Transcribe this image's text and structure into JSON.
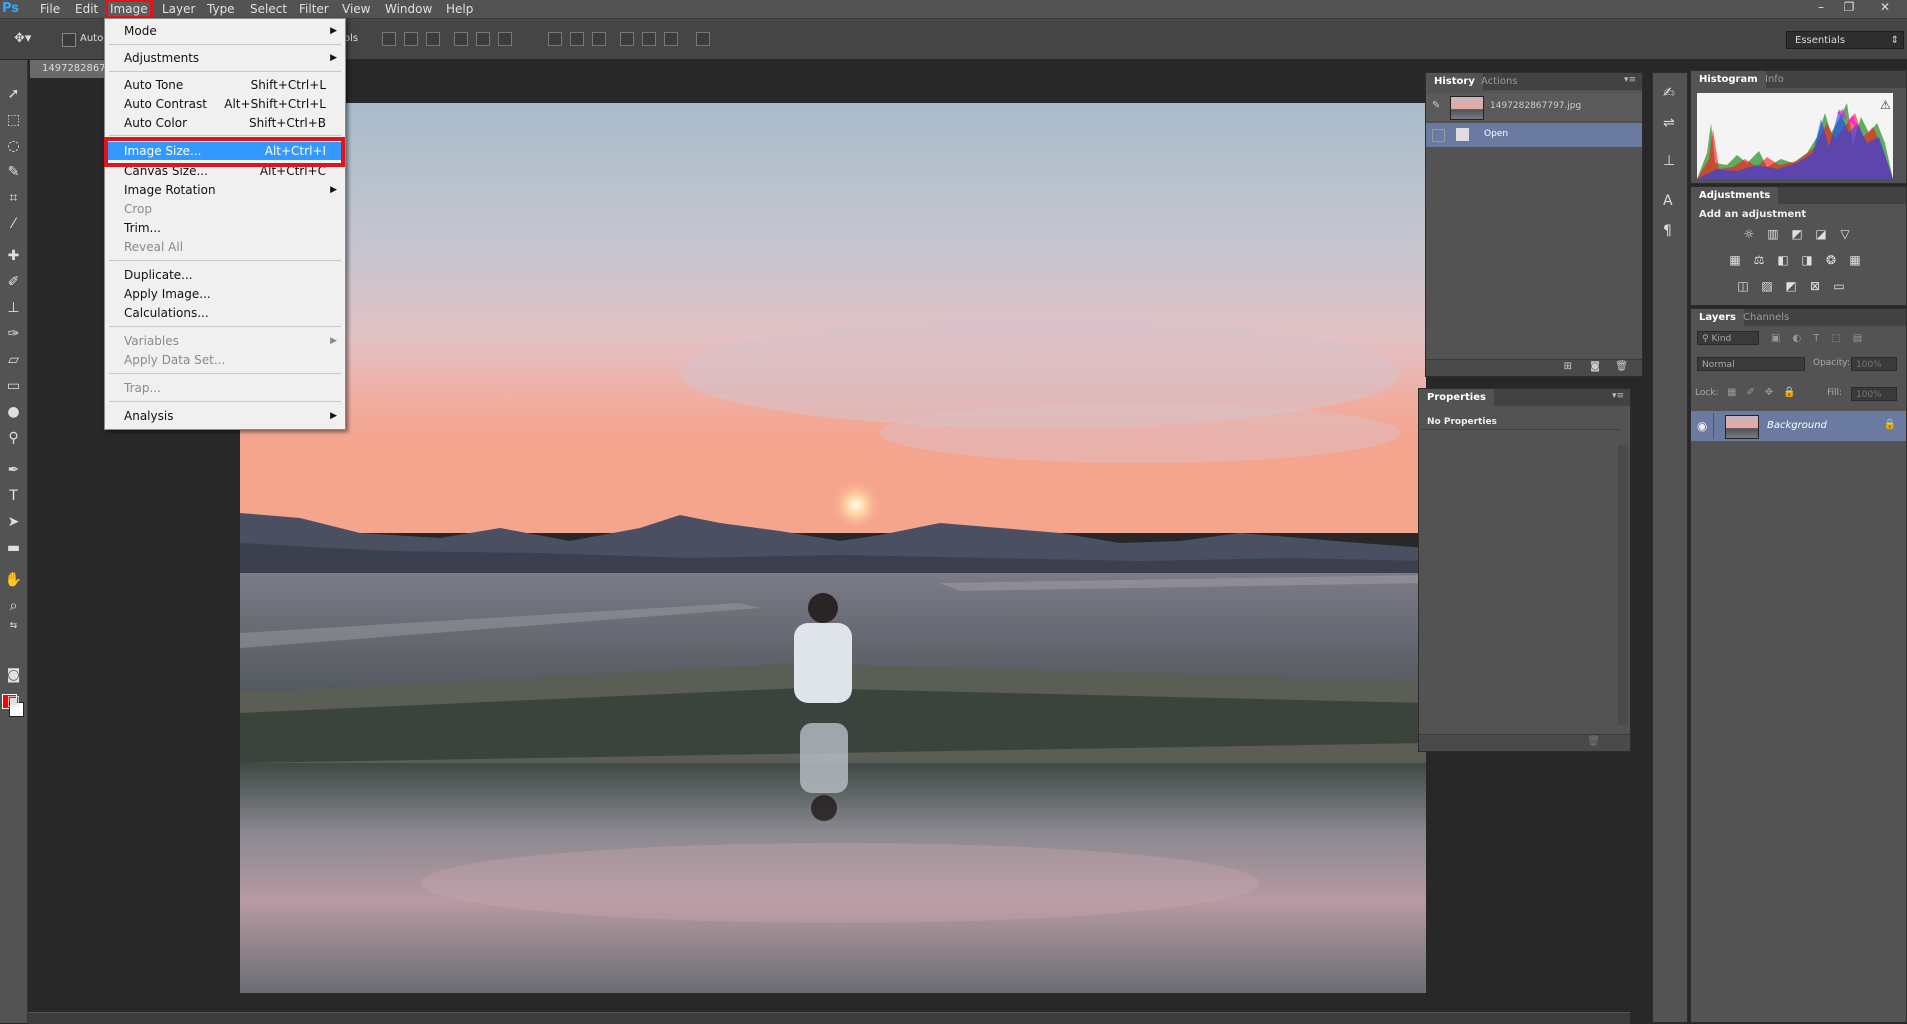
{
  "app": {
    "logo": "Ps"
  },
  "menubar": {
    "items": [
      "File",
      "Edit",
      "Image",
      "Layer",
      "Type",
      "Select",
      "Filter",
      "View",
      "Window",
      "Help"
    ],
    "active": "Image",
    "window_controls": [
      "–",
      "❐",
      "✕"
    ]
  },
  "options_bar": {
    "auto_select_label": "Auto-",
    "show_transform_label": "ols",
    "workspace": "Essentials"
  },
  "document": {
    "tab_title": "1497282867"
  },
  "image_menu": {
    "items": [
      {
        "label": "Mode",
        "shortcut": "",
        "submenu": true,
        "disabled": false,
        "highlighted": false
      },
      {
        "label": "Adjustments",
        "shortcut": "",
        "submenu": true,
        "disabled": false,
        "highlighted": false
      },
      {
        "label": "Auto Tone",
        "shortcut": "Shift+Ctrl+L",
        "submenu": false,
        "disabled": false,
        "highlighted": false
      },
      {
        "label": "Auto Contrast",
        "shortcut": "Alt+Shift+Ctrl+L",
        "submenu": false,
        "disabled": false,
        "highlighted": false
      },
      {
        "label": "Auto Color",
        "shortcut": "Shift+Ctrl+B",
        "submenu": false,
        "disabled": false,
        "highlighted": false
      },
      {
        "label": "Image Size...",
        "shortcut": "Alt+Ctrl+I",
        "submenu": false,
        "disabled": false,
        "highlighted": true
      },
      {
        "label": "Canvas Size...",
        "shortcut": "Alt+Ctrl+C",
        "submenu": false,
        "disabled": false,
        "highlighted": false
      },
      {
        "label": "Image Rotation",
        "shortcut": "",
        "submenu": true,
        "disabled": false,
        "highlighted": false
      },
      {
        "label": "Crop",
        "shortcut": "",
        "submenu": false,
        "disabled": true,
        "highlighted": false
      },
      {
        "label": "Trim...",
        "shortcut": "",
        "submenu": false,
        "disabled": false,
        "highlighted": false
      },
      {
        "label": "Reveal All",
        "shortcut": "",
        "submenu": false,
        "disabled": true,
        "highlighted": false
      },
      {
        "label": "Duplicate...",
        "shortcut": "",
        "submenu": false,
        "disabled": false,
        "highlighted": false
      },
      {
        "label": "Apply Image...",
        "shortcut": "",
        "submenu": false,
        "disabled": false,
        "highlighted": false
      },
      {
        "label": "Calculations...",
        "shortcut": "",
        "submenu": false,
        "disabled": false,
        "highlighted": false
      },
      {
        "label": "Variables",
        "shortcut": "",
        "submenu": true,
        "disabled": true,
        "highlighted": false
      },
      {
        "label": "Apply Data Set...",
        "shortcut": "",
        "submenu": false,
        "disabled": true,
        "highlighted": false
      },
      {
        "label": "Trap...",
        "shortcut": "",
        "submenu": false,
        "disabled": true,
        "highlighted": false
      },
      {
        "label": "Analysis",
        "shortcut": "",
        "submenu": true,
        "disabled": false,
        "highlighted": false
      }
    ]
  },
  "history_panel": {
    "tabs": [
      "History",
      "Actions"
    ],
    "snapshot_name": "1497282867797.jpg",
    "states": [
      "Open"
    ]
  },
  "properties_panel": {
    "title": "Properties",
    "message": "No Properties"
  },
  "histogram_panel": {
    "tabs": [
      "Histogram",
      "Info"
    ]
  },
  "adjustments_panel": {
    "title": "Adjustments",
    "subtitle": "Add an adjustment"
  },
  "layers_panel": {
    "tabs": [
      "Layers",
      "Channels"
    ],
    "filter_label": "Kind",
    "blend_mode": "Normal",
    "opacity_label": "Opacity:",
    "opacity_value": "100%",
    "lock_label": "Lock:",
    "fill_label": "Fill:",
    "fill_value": "100%",
    "layers": [
      {
        "name": "Background",
        "visible": true,
        "locked": true
      }
    ]
  },
  "colors": {
    "foreground": "#ff0000",
    "background": "#ffffff",
    "highlight": "#3399ff",
    "annotation_red": "#e3131b"
  }
}
